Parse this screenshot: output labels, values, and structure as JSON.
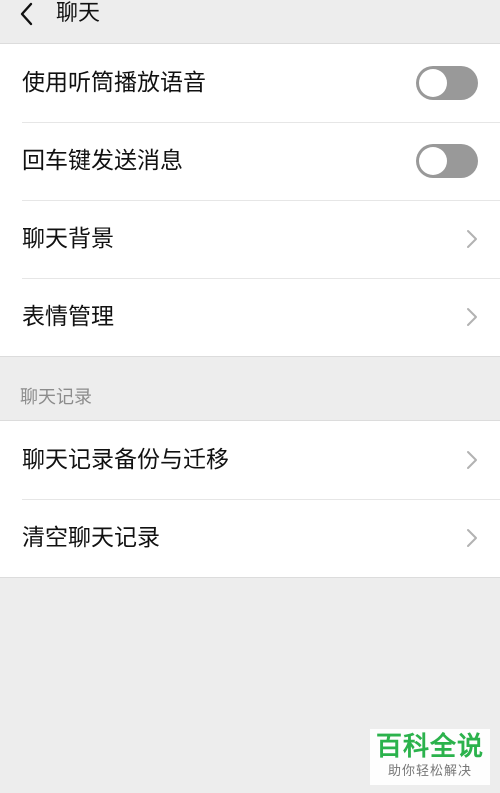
{
  "header": {
    "title": "聊天",
    "back_icon": "chevron-left-icon"
  },
  "settings_group": {
    "items": [
      {
        "label": "使用听筒播放语音",
        "control": "toggle",
        "state": "off"
      },
      {
        "label": "回车键发送消息",
        "control": "toggle",
        "state": "off"
      },
      {
        "label": "聊天背景",
        "control": "chevron"
      },
      {
        "label": "表情管理",
        "control": "chevron"
      }
    ]
  },
  "history_section": {
    "title": "聊天记录",
    "items": [
      {
        "label": "聊天记录备份与迁移",
        "control": "chevron"
      },
      {
        "label": "清空聊天记录",
        "control": "chevron"
      }
    ]
  },
  "watermark": {
    "main": "百科全说",
    "sub": "助你轻松解决"
  },
  "colors": {
    "background": "#ededed",
    "toggle_off": "#999999",
    "watermark_green": "#2bb24c"
  }
}
